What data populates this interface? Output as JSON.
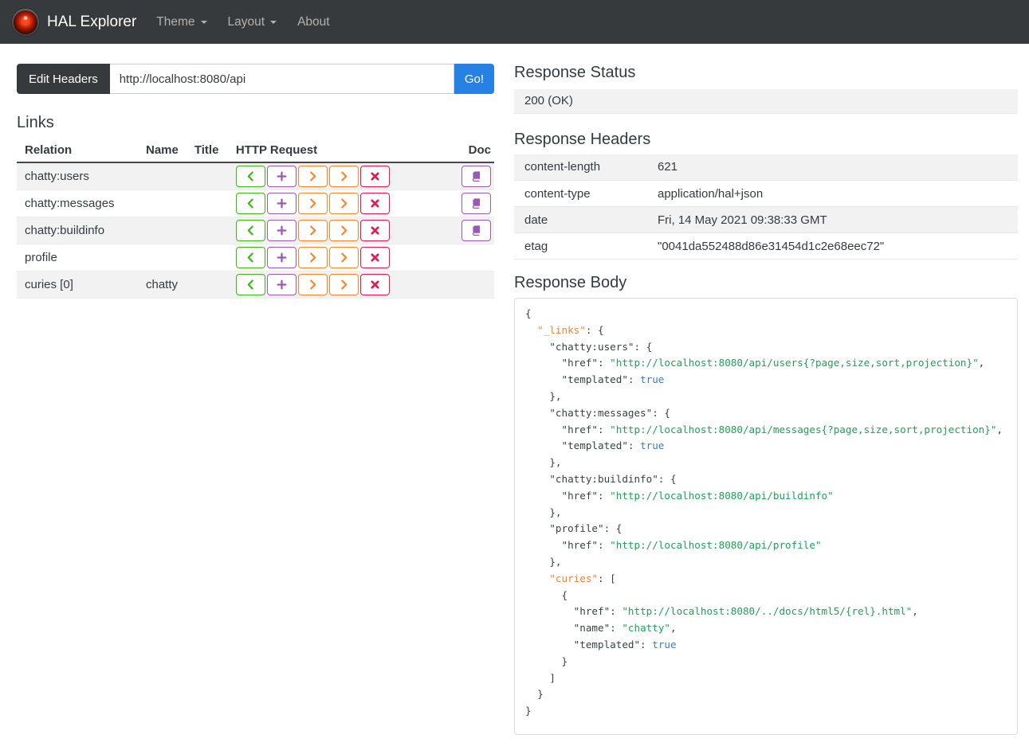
{
  "navbar": {
    "brand": "HAL Explorer",
    "items": [
      {
        "label": "Theme",
        "dropdown": true
      },
      {
        "label": "Layout",
        "dropdown": true
      },
      {
        "label": "About",
        "dropdown": false
      }
    ]
  },
  "request_bar": {
    "edit_headers_label": "Edit Headers",
    "url_value": "http://localhost:8080/api",
    "go_label": "Go!"
  },
  "links": {
    "heading": "Links",
    "columns": [
      "Relation",
      "Name",
      "Title",
      "HTTP Request",
      "Doc"
    ],
    "http_request_buttons": [
      {
        "method": "GET",
        "icon": "chevron-left",
        "color": "get_green"
      },
      {
        "method": "POST",
        "icon": "plus",
        "color": "post_purple"
      },
      {
        "method": "PUT",
        "icon": "chevron-right",
        "color": "put_orange"
      },
      {
        "method": "PATCH",
        "icon": "chevron-right",
        "color": "patch_orange"
      },
      {
        "method": "DELETE",
        "icon": "cross",
        "color": "delete_red"
      }
    ],
    "rows": [
      {
        "relation": "chatty:users",
        "name": "",
        "title": "",
        "doc": true
      },
      {
        "relation": "chatty:messages",
        "name": "",
        "title": "",
        "doc": true
      },
      {
        "relation": "chatty:buildinfo",
        "name": "",
        "title": "",
        "doc": true
      },
      {
        "relation": "profile",
        "name": "",
        "title": "",
        "doc": false
      },
      {
        "relation": "curies [0]",
        "name": "chatty",
        "title": "",
        "doc": false
      }
    ]
  },
  "response_status": {
    "heading": "Response Status",
    "value": "200 (OK)"
  },
  "response_headers": {
    "heading": "Response Headers",
    "rows": [
      {
        "name": "content-length",
        "value": "621"
      },
      {
        "name": "content-type",
        "value": "application/hal+json"
      },
      {
        "name": "date",
        "value": "Fri, 14 May 2021 09:38:33 GMT"
      },
      {
        "name": "etag",
        "value": "\"0041da552488d86e31454d1c2e68eec72\""
      }
    ]
  },
  "response_body": {
    "heading": "Response Body",
    "lines": [
      [
        {
          "t": "{",
          "c": "p"
        }
      ],
      [
        {
          "t": "  ",
          "c": "p"
        },
        {
          "t": "\"_links\"",
          "c": "k"
        },
        {
          "t": ": {",
          "c": "p"
        }
      ],
      [
        {
          "t": "    \"chatty:users\": {",
          "c": "p"
        }
      ],
      [
        {
          "t": "      \"href\": ",
          "c": "p"
        },
        {
          "t": "\"http://localhost:8080/api/users{?page,size,sort,projection}\"",
          "c": "s"
        },
        {
          "t": ",",
          "c": "p"
        }
      ],
      [
        {
          "t": "      \"templated\": ",
          "c": "p"
        },
        {
          "t": "true",
          "c": "b"
        }
      ],
      [
        {
          "t": "    },",
          "c": "p"
        }
      ],
      [
        {
          "t": "    \"chatty:messages\": {",
          "c": "p"
        }
      ],
      [
        {
          "t": "      \"href\": ",
          "c": "p"
        },
        {
          "t": "\"http://localhost:8080/api/messages{?page,size,sort,projection}\"",
          "c": "s"
        },
        {
          "t": ",",
          "c": "p"
        }
      ],
      [
        {
          "t": "      \"templated\": ",
          "c": "p"
        },
        {
          "t": "true",
          "c": "b"
        }
      ],
      [
        {
          "t": "    },",
          "c": "p"
        }
      ],
      [
        {
          "t": "    \"chatty:buildinfo\": {",
          "c": "p"
        }
      ],
      [
        {
          "t": "      \"href\": ",
          "c": "p"
        },
        {
          "t": "\"http://localhost:8080/api/buildinfo\"",
          "c": "s"
        }
      ],
      [
        {
          "t": "    },",
          "c": "p"
        }
      ],
      [
        {
          "t": "    \"profile\": {",
          "c": "p"
        }
      ],
      [
        {
          "t": "      \"href\": ",
          "c": "p"
        },
        {
          "t": "\"http://localhost:8080/api/profile\"",
          "c": "s"
        }
      ],
      [
        {
          "t": "    },",
          "c": "p"
        }
      ],
      [
        {
          "t": "    ",
          "c": "p"
        },
        {
          "t": "\"curies\"",
          "c": "k"
        },
        {
          "t": ": [",
          "c": "p"
        }
      ],
      [
        {
          "t": "      {",
          "c": "p"
        }
      ],
      [
        {
          "t": "        \"href\": ",
          "c": "p"
        },
        {
          "t": "\"http://localhost:8080/../docs/html5/{rel}.html\"",
          "c": "s"
        },
        {
          "t": ",",
          "c": "p"
        }
      ],
      [
        {
          "t": "        \"name\": ",
          "c": "p"
        },
        {
          "t": "\"chatty\"",
          "c": "s"
        },
        {
          "t": ",",
          "c": "p"
        }
      ],
      [
        {
          "t": "        \"templated\": ",
          "c": "p"
        },
        {
          "t": "true",
          "c": "b"
        }
      ],
      [
        {
          "t": "      }",
          "c": "p"
        }
      ],
      [
        {
          "t": "    ]",
          "c": "p"
        }
      ],
      [
        {
          "t": "  }",
          "c": "p"
        }
      ],
      [
        {
          "t": "}",
          "c": "p"
        }
      ]
    ]
  },
  "colors": {
    "navbar_bg": "#373a3c",
    "text": "#373a3c",
    "primary": "#2780e3",
    "stripe": "#f2f2f2",
    "get_green": "#3fb618",
    "post_purple": "#9b59b6",
    "put_orange": "#f7862d",
    "patch_orange": "#f7862d",
    "delete_red": "#e9184c",
    "doc_purple": "#9b59b6",
    "json_key_special": "#ef8436",
    "json_string": "#1da258",
    "json_boolean": "#3e7cc4"
  }
}
